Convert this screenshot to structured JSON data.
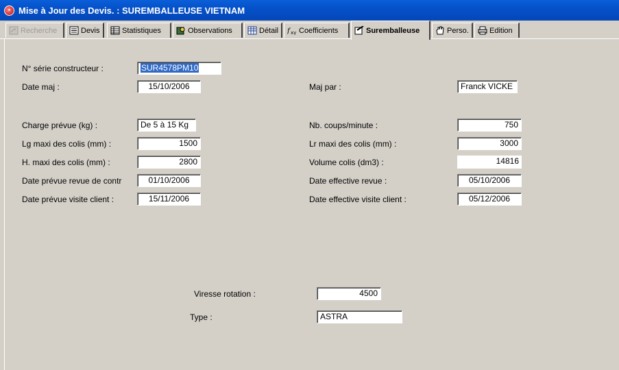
{
  "window": {
    "title": "Mise à Jour des Devis. : SUREMBALLEUSE VIETNAM",
    "icon": "app-logo-icon"
  },
  "tabs": [
    {
      "label": "Recherche",
      "icon": "search-card-icon",
      "state": "disabled"
    },
    {
      "label": "Devis",
      "icon": "document-list-icon",
      "state": "normal"
    },
    {
      "label": "Statistiques",
      "icon": "statistics-table-icon",
      "state": "normal"
    },
    {
      "label": "Observations",
      "icon": "observations-icon",
      "state": "normal"
    },
    {
      "label": "Détail",
      "icon": "grid-detail-icon",
      "state": "normal"
    },
    {
      "label": "Coefficients",
      "icon": "formula-icon",
      "state": "normal"
    },
    {
      "label": "Suremballeuse",
      "icon": "edit-checkbox-icon",
      "state": "active"
    },
    {
      "label": "Perso.",
      "icon": "hand-icon",
      "state": "normal"
    },
    {
      "label": "Edition",
      "icon": "printer-icon",
      "state": "normal"
    }
  ],
  "form": {
    "serial": {
      "label": "N° série constructeur :",
      "value": "SUR4578PM10"
    },
    "date_maj": {
      "label": "Date maj :",
      "value": "15/10/2006"
    },
    "maj_par": {
      "label": "Maj par :",
      "value": "Franck VICKE"
    },
    "charge": {
      "label": "Charge prévue (kg) :",
      "value": "De 5 à 15 Kg"
    },
    "coups": {
      "label": "Nb. coups/minute :",
      "value": "750"
    },
    "lg_maxi": {
      "label": "Lg maxi des colis (mm) :",
      "value": "1500"
    },
    "lr_maxi": {
      "label": "Lr maxi des colis (mm) :",
      "value": "3000"
    },
    "h_maxi": {
      "label": "H. maxi des colis (mm) :",
      "value": "2800"
    },
    "volume": {
      "label": "Volume colis (dm3) :",
      "value": "14816"
    },
    "date_revue_prevue": {
      "label": "Date prévue revue de contr",
      "value": "01/10/2006"
    },
    "date_revue_effective": {
      "label": "Date effective revue :",
      "value": "05/10/2006"
    },
    "date_visite_prevue": {
      "label": "Date prévue visite client :",
      "value": "15/11/2006"
    },
    "date_visite_effective": {
      "label": "Date effective visite client :",
      "value": "05/12/2006"
    },
    "rotation": {
      "label": "Viresse rotation  :",
      "value": "4500"
    },
    "type": {
      "label": "Type :",
      "value": "ASTRA"
    }
  }
}
